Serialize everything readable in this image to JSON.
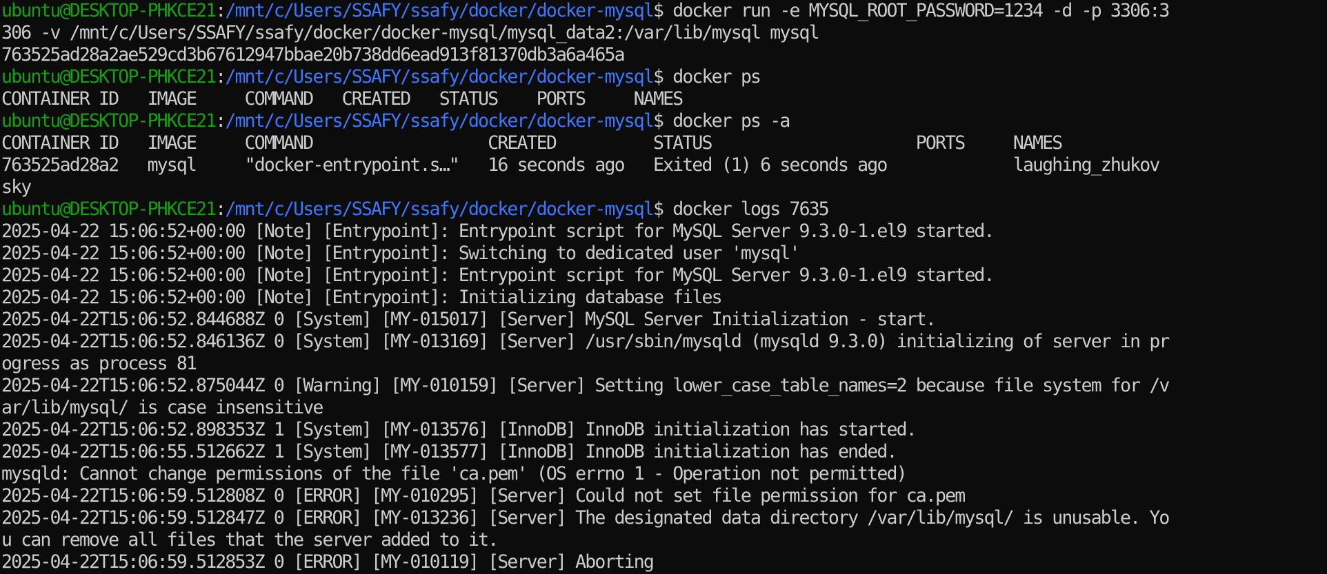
{
  "theme": {
    "background": "#0c0c0c",
    "foreground": "#cccccc",
    "user_host_color": "#13a10e",
    "path_color": "#3b78ff"
  },
  "prompt": {
    "user_host": "ubuntu@DESKTOP-PHKCE21",
    "separator": ":",
    "path": "/mnt/c/Users/SSAFY/ssafy/docker/docker-mysql",
    "symbol": "$ "
  },
  "lines": [
    {
      "type": "prompt",
      "command": "docker run -e MYSQL_ROOT_PASSWORD=1234 -d -p 3306:3"
    },
    {
      "type": "output",
      "text": "306 -v /mnt/c/Users/SSAFY/ssafy/docker/docker-mysql/mysql_data2:/var/lib/mysql mysql"
    },
    {
      "type": "output",
      "text": "763525ad28a2ae529cd3b67612947bbae20b738dd6ead913f81370db3a6a465a"
    },
    {
      "type": "prompt",
      "command": "docker ps"
    },
    {
      "type": "output",
      "text": "CONTAINER ID   IMAGE     COMMAND   CREATED   STATUS    PORTS     NAMES"
    },
    {
      "type": "prompt",
      "command": "docker ps -a"
    },
    {
      "type": "output",
      "text": "CONTAINER ID   IMAGE     COMMAND                  CREATED          STATUS                     PORTS     NAMES"
    },
    {
      "type": "output",
      "text": "763525ad28a2   mysql     \"docker-entrypoint.s…\"   16 seconds ago   Exited (1) 6 seconds ago             laughing_zhukov"
    },
    {
      "type": "output",
      "text": "sky"
    },
    {
      "type": "prompt",
      "command": "docker logs 7635"
    },
    {
      "type": "output",
      "text": "2025-04-22 15:06:52+00:00 [Note] [Entrypoint]: Entrypoint script for MySQL Server 9.3.0-1.el9 started."
    },
    {
      "type": "output",
      "text": "2025-04-22 15:06:52+00:00 [Note] [Entrypoint]: Switching to dedicated user 'mysql'"
    },
    {
      "type": "output",
      "text": "2025-04-22 15:06:52+00:00 [Note] [Entrypoint]: Entrypoint script for MySQL Server 9.3.0-1.el9 started."
    },
    {
      "type": "output",
      "text": "2025-04-22 15:06:52+00:00 [Note] [Entrypoint]: Initializing database files"
    },
    {
      "type": "output",
      "text": "2025-04-22T15:06:52.844688Z 0 [System] [MY-015017] [Server] MySQL Server Initialization - start."
    },
    {
      "type": "output",
      "text": "2025-04-22T15:06:52.846136Z 0 [System] [MY-013169] [Server] /usr/sbin/mysqld (mysqld 9.3.0) initializing of server in pr"
    },
    {
      "type": "output",
      "text": "ogress as process 81"
    },
    {
      "type": "output",
      "text": "2025-04-22T15:06:52.875044Z 0 [Warning] [MY-010159] [Server] Setting lower_case_table_names=2 because file system for /v"
    },
    {
      "type": "output",
      "text": "ar/lib/mysql/ is case insensitive"
    },
    {
      "type": "output",
      "text": "2025-04-22T15:06:52.898353Z 1 [System] [MY-013576] [InnoDB] InnoDB initialization has started."
    },
    {
      "type": "output",
      "text": "2025-04-22T15:06:55.512662Z 1 [System] [MY-013577] [InnoDB] InnoDB initialization has ended."
    },
    {
      "type": "output",
      "text": "mysqld: Cannot change permissions of the file 'ca.pem' (OS errno 1 - Operation not permitted)"
    },
    {
      "type": "output",
      "text": "2025-04-22T15:06:59.512808Z 0 [ERROR] [MY-010295] [Server] Could not set file permission for ca.pem"
    },
    {
      "type": "output",
      "text": "2025-04-22T15:06:59.512847Z 0 [ERROR] [MY-013236] [Server] The designated data directory /var/lib/mysql/ is unusable. Yo"
    },
    {
      "type": "output",
      "text": "u can remove all files that the server added to it."
    },
    {
      "type": "output",
      "text": "2025-04-22T15:06:59.512853Z 0 [ERROR] [MY-010119] [Server] Aborting"
    }
  ]
}
